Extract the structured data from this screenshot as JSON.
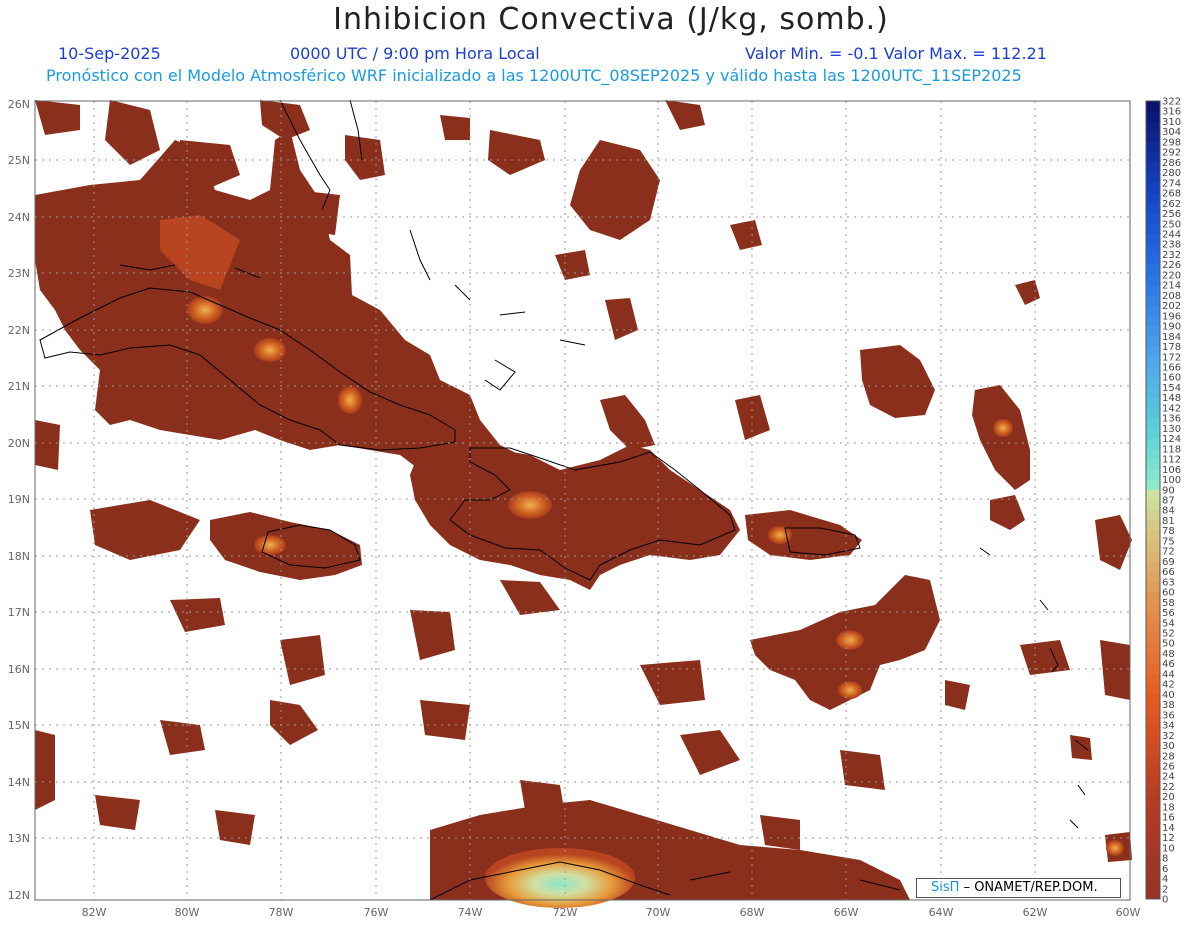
{
  "header": {
    "title": "Inhibicion Convectiva (J/kg, somb.)",
    "date": "10-Sep-2025",
    "time": "0000 UTC / 9:00 pm Hora Local",
    "minmax": "Valor Min. = -0.1  Valor Max. = 112.21",
    "subtitle": "Pronóstico con el Modelo Atmosférico WRF inicializado a las 1200UTC_08SEP2025 y válido hasta las  1200UTC_11SEP2025"
  },
  "map": {
    "lat_range": [
      12,
      26
    ],
    "lon_range": [
      -83.25,
      -60
    ],
    "lat_labels": [
      "26N",
      "25N",
      "24N",
      "23N",
      "22N",
      "21N",
      "20N",
      "19N",
      "18N",
      "17N",
      "16N",
      "15N",
      "14N",
      "13N",
      "12N"
    ],
    "lon_labels": [
      "82W",
      "80W",
      "78W",
      "76W",
      "74W",
      "72W",
      "70W",
      "68W",
      "66W",
      "64W",
      "62W",
      "60W"
    ],
    "colors": {
      "low": "#8b2f1d",
      "mid": "#c84a1e",
      "high": "#e6892a",
      "peak": "#cfe0a0",
      "max": "#8fe6c8"
    }
  },
  "colorbar": {
    "labels": [
      "322",
      "316",
      "310",
      "304",
      "298",
      "292",
      "286",
      "280",
      "274",
      "268",
      "262",
      "256",
      "250",
      "244",
      "238",
      "232",
      "226",
      "220",
      "214",
      "208",
      "202",
      "196",
      "190",
      "184",
      "178",
      "172",
      "166",
      "160",
      "154",
      "148",
      "142",
      "136",
      "130",
      "124",
      "118",
      "112",
      "106",
      "100",
      "90",
      "87",
      "84",
      "81",
      "78",
      "75",
      "72",
      "69",
      "66",
      "63",
      "60",
      "58",
      "56",
      "54",
      "52",
      "50",
      "48",
      "46",
      "44",
      "42",
      "40",
      "38",
      "36",
      "34",
      "32",
      "30",
      "28",
      "26",
      "24",
      "22",
      "20",
      "18",
      "16",
      "14",
      "12",
      "10",
      "8",
      "6",
      "4",
      "2",
      "0"
    ]
  },
  "credit": {
    "sis": "SisΠ",
    "org": "– ONAMET/REP.DOM."
  }
}
